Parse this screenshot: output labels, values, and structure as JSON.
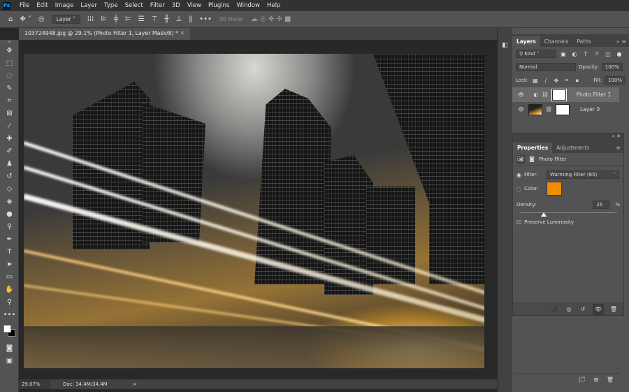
{
  "app": {
    "logo": "Ps"
  },
  "menu": [
    "File",
    "Edit",
    "Image",
    "Layer",
    "Type",
    "Select",
    "Filter",
    "3D",
    "View",
    "Plugins",
    "Window",
    "Help"
  ],
  "options": {
    "auto_select": "Layer",
    "mode_3d": "3D Mode:"
  },
  "document": {
    "tab_title": "103724948.jpg @ 29.1% (Photo Filter 1, Layer Mask/8) *"
  },
  "status": {
    "zoom": "29.07%",
    "doc": "Doc: 34.4M/34.4M",
    "arrow": ">"
  },
  "layers_panel": {
    "tabs": [
      "Layers",
      "Channels",
      "Paths"
    ],
    "filter_kind": "Kind",
    "blend_mode": "Normal",
    "opacity_label": "Opacity:",
    "opacity": "100%",
    "lock_label": "Lock:",
    "fill_label": "Fill:",
    "fill": "100%",
    "layers": [
      {
        "name": "Photo Filter 1",
        "selected": true,
        "visible": true
      },
      {
        "name": "Layer 0",
        "selected": false,
        "visible": true
      }
    ]
  },
  "properties_panel": {
    "tabs": [
      "Properties",
      "Adjustments"
    ],
    "title": "Photo Filter",
    "filter_label": "Filter:",
    "filter_value": "Warming Filter (85)",
    "color_label": "Color:",
    "color": "#f08c00",
    "density_label": "Density:",
    "density": "25",
    "density_unit": "%",
    "preserve_label": "Preserve Luminosity",
    "preserve_checked": true
  },
  "colors": {
    "accent_swatch": "#f08c00",
    "panel_bg": "#535353"
  }
}
